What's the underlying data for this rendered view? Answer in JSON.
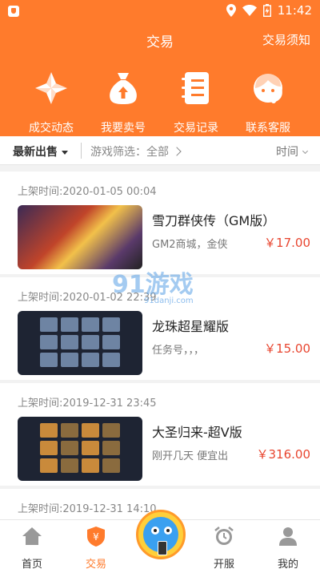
{
  "status_bar": {
    "time": "11:42"
  },
  "header": {
    "title": "交易",
    "rules_link": "交易须知"
  },
  "quick_actions": [
    {
      "label": "成交动态",
      "icon": "pinwheel-icon"
    },
    {
      "label": "我要卖号",
      "icon": "money-bag-icon"
    },
    {
      "label": "交易记录",
      "icon": "notebook-icon"
    },
    {
      "label": "联系客服",
      "icon": "headset-icon"
    }
  ],
  "filter": {
    "sort_label": "最新出售",
    "game_filter": "游戏筛选：全部",
    "time_sort": "时间"
  },
  "listings": [
    {
      "time": "上架时间:2020-01-05 00:04",
      "name": "雪刀群侠传（GM版）",
      "desc": "GM2商城，金侠",
      "price": "￥17.00"
    },
    {
      "time": "上架时间:2020-01-02 22:39",
      "name": "龙珠超星耀版",
      "desc": "任务号，，，",
      "price": "￥15.00"
    },
    {
      "time": "上架时间:2019-12-31 23:45",
      "name": "大圣归来-超V版",
      "desc": "刚开几天 便宜出",
      "price": "￥316.00"
    },
    {
      "time": "上架时间:2019-12-31 14:10"
    }
  ],
  "watermark": {
    "main": "91游戏",
    "sub": "91danji.com"
  },
  "tabbar": [
    {
      "label": "首页",
      "icon": "home-icon"
    },
    {
      "label": "交易",
      "icon": "shield-yen-icon"
    },
    {
      "label": "开服",
      "icon": "alarm-clock-icon"
    },
    {
      "label": "我的",
      "icon": "person-icon"
    }
  ],
  "colors": {
    "brand": "#ff7b2c",
    "price": "#e8452f"
  }
}
